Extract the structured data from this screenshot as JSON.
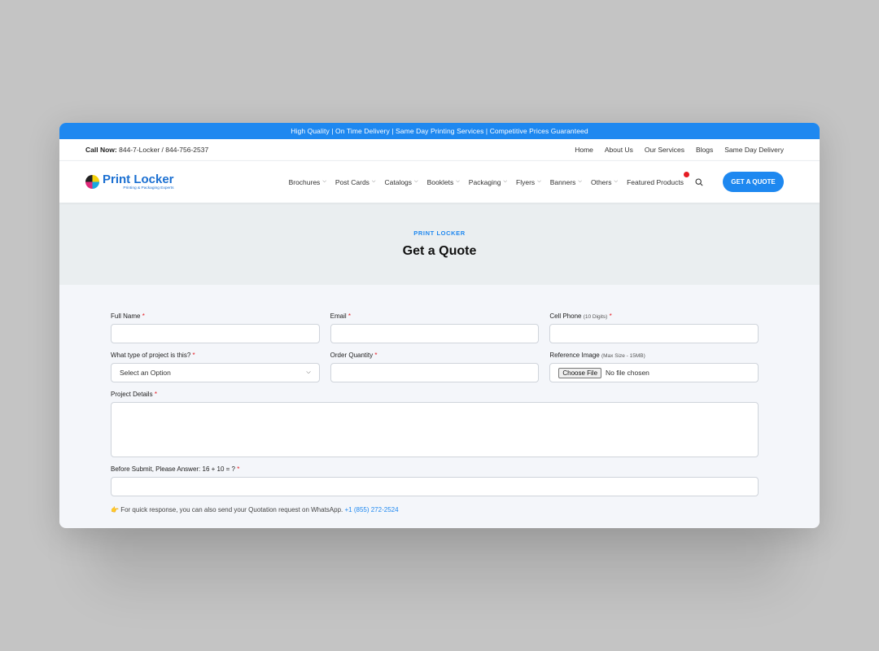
{
  "announcement": "High Quality | On Time Delivery | Same Day Printing Services | Competitive Prices Guaranteed",
  "topbar": {
    "call_label": "Call Now:",
    "call_numbers": "844-7-Locker / 844-756-2537",
    "links": [
      "Home",
      "About Us",
      "Our Services",
      "Blogs",
      "Same Day Delivery"
    ]
  },
  "logo": {
    "title": "Print Locker",
    "tagline": "Printing & Packaging Experts"
  },
  "nav": {
    "items": [
      "Brochures",
      "Post Cards",
      "Catalogs",
      "Booklets",
      "Packaging",
      "Flyers",
      "Banners",
      "Others"
    ],
    "featured": "Featured Products",
    "cta": "GET A QUOTE"
  },
  "hero": {
    "eyebrow": "PRINT LOCKER",
    "title": "Get a Quote"
  },
  "form": {
    "full_name": "Full Name",
    "email": "Email",
    "cell_phone": "Cell Phone",
    "cell_phone_note": "(10 Digits)",
    "project_type": "What type of project is this?",
    "project_type_value": "Select an Option",
    "order_quantity": "Order Quantity",
    "reference_image": "Reference Image",
    "reference_image_note": "(Max Size - 15MB)",
    "file_button": "Choose File",
    "file_status": "No file chosen",
    "project_details": "Project Details",
    "captcha": "Before Submit, Please Answer: 16 + 10 = ?",
    "required_mark": "*"
  },
  "footnote": {
    "emoji": "👉",
    "text": "For quick response, you can also send your Quotation request on WhatsApp.",
    "phone": "+1 (855) 272-2524"
  },
  "colors": {
    "brand": "#1e88f0",
    "required": "#e51c23",
    "hero_bg": "#eaeef0"
  }
}
